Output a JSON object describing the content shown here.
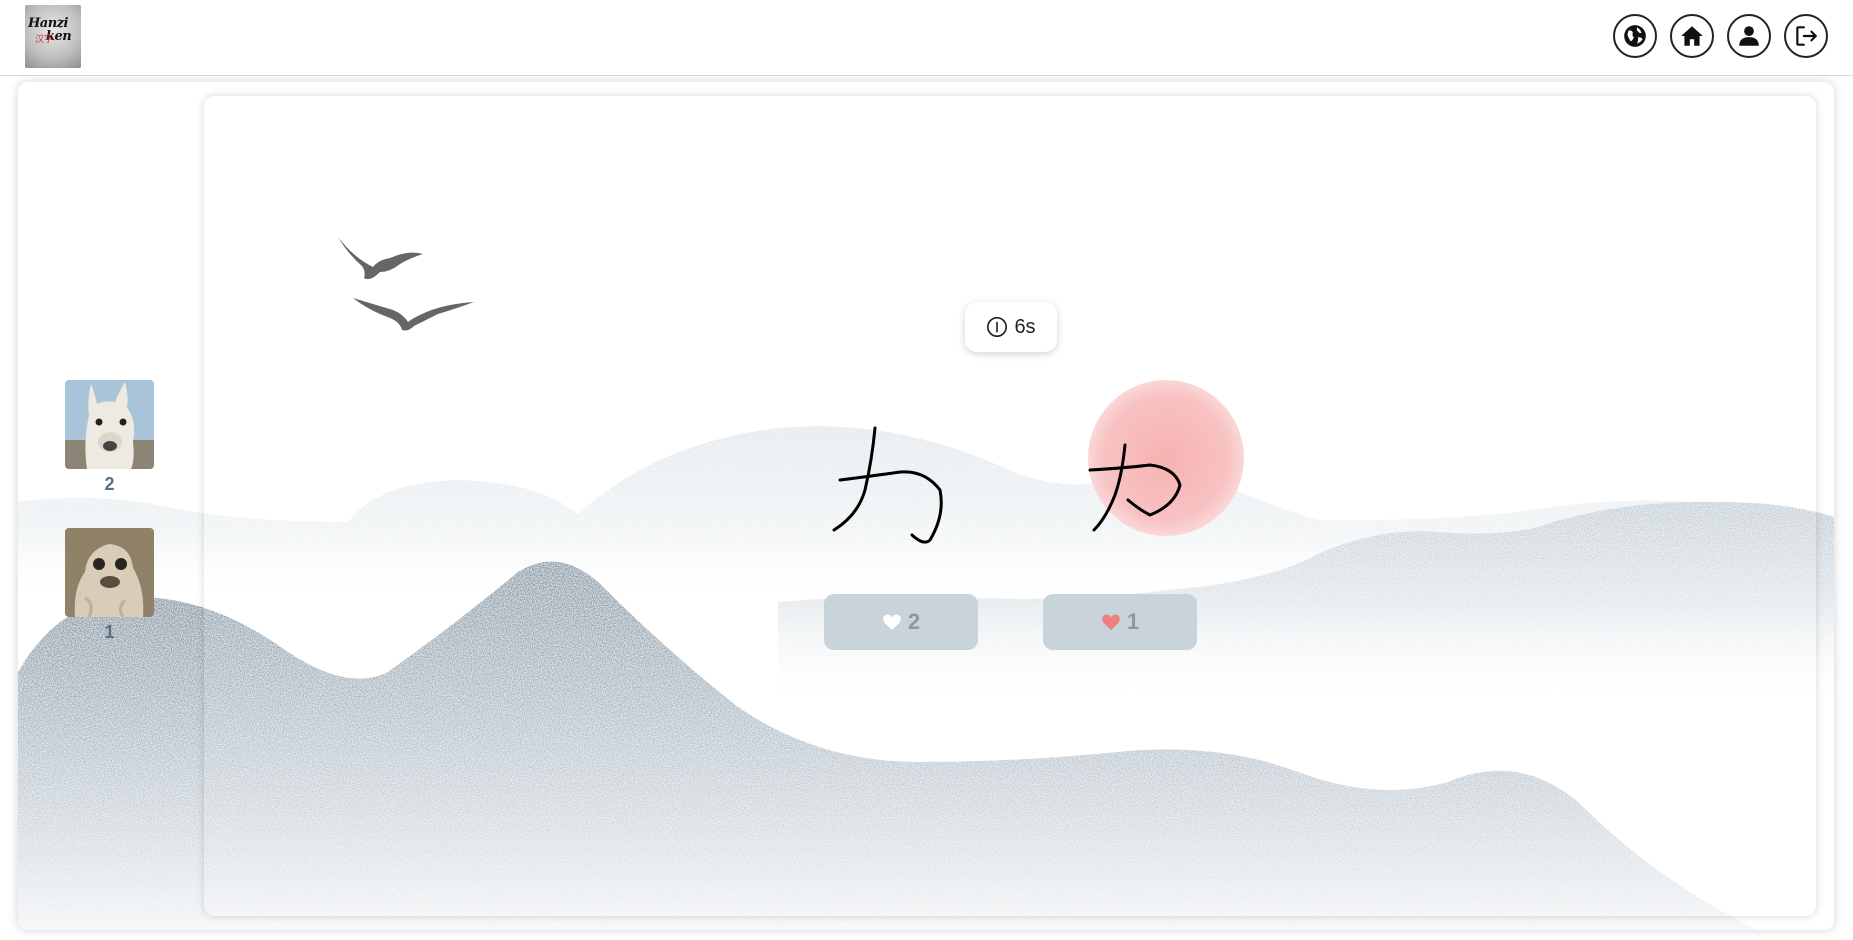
{
  "header": {
    "logo_text_line1": "Hanzi",
    "logo_text_line2": "ken",
    "logo_mark": "汉字",
    "nav": [
      {
        "name": "globe-icon",
        "label": "Language"
      },
      {
        "name": "home-icon",
        "label": "Home"
      },
      {
        "name": "user-icon",
        "label": "Profile"
      },
      {
        "name": "logout-icon",
        "label": "Log out"
      }
    ]
  },
  "players": [
    {
      "avatar": "llama",
      "score": "2"
    },
    {
      "avatar": "seal",
      "score": "1"
    }
  ],
  "timer": {
    "value": "6s",
    "icon": "info-icon"
  },
  "votes": [
    {
      "count": "2",
      "heart_color": "#ffffff"
    },
    {
      "count": "1",
      "heart_color": "#f08080"
    }
  ],
  "colors": {
    "sun": "#f8b4b4",
    "mountain_dark": "#6f8696",
    "mountain_light": "#c7d1d9",
    "button_bg": "#c9d3da"
  }
}
